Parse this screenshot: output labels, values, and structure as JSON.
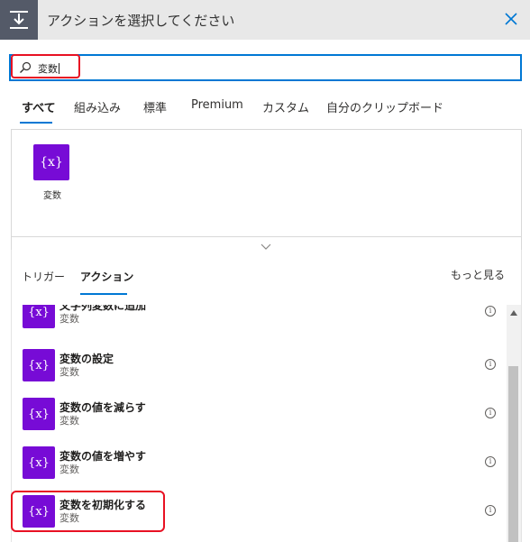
{
  "header": {
    "title": "アクションを選択してください",
    "icon": "action-insert-icon",
    "close_icon": "close-icon"
  },
  "search": {
    "value": "変数",
    "icon": "search-icon"
  },
  "category_tabs": [
    {
      "label": "すべて",
      "active": true
    },
    {
      "label": "組み込み"
    },
    {
      "label": "標準"
    },
    {
      "label": "Premium"
    },
    {
      "label": "カスタム"
    },
    {
      "label": "自分のクリップボード"
    }
  ],
  "connectors": [
    {
      "name": "変数",
      "icon_glyph": "{x}"
    }
  ],
  "sub_tabs": [
    {
      "label": "トリガー"
    },
    {
      "label": "アクション",
      "active": true
    }
  ],
  "see_more": "もっと見る",
  "actions": [
    {
      "title": "文字列変数に追加",
      "subtitle": "変数"
    },
    {
      "title": "変数の設定",
      "subtitle": "変数"
    },
    {
      "title": "変数の値を減らす",
      "subtitle": "変数"
    },
    {
      "title": "変数の値を増やす",
      "subtitle": "変数"
    },
    {
      "title": "変数を初期化する",
      "subtitle": "変数"
    }
  ],
  "tile_glyph": "{x}",
  "info_glyph": "i",
  "colors": {
    "accent": "#0078d4",
    "variable_tile": "#770bd6",
    "highlight": "#e81123",
    "header_bg": "#e8e8e8",
    "header_icon_bg": "#545a68"
  }
}
